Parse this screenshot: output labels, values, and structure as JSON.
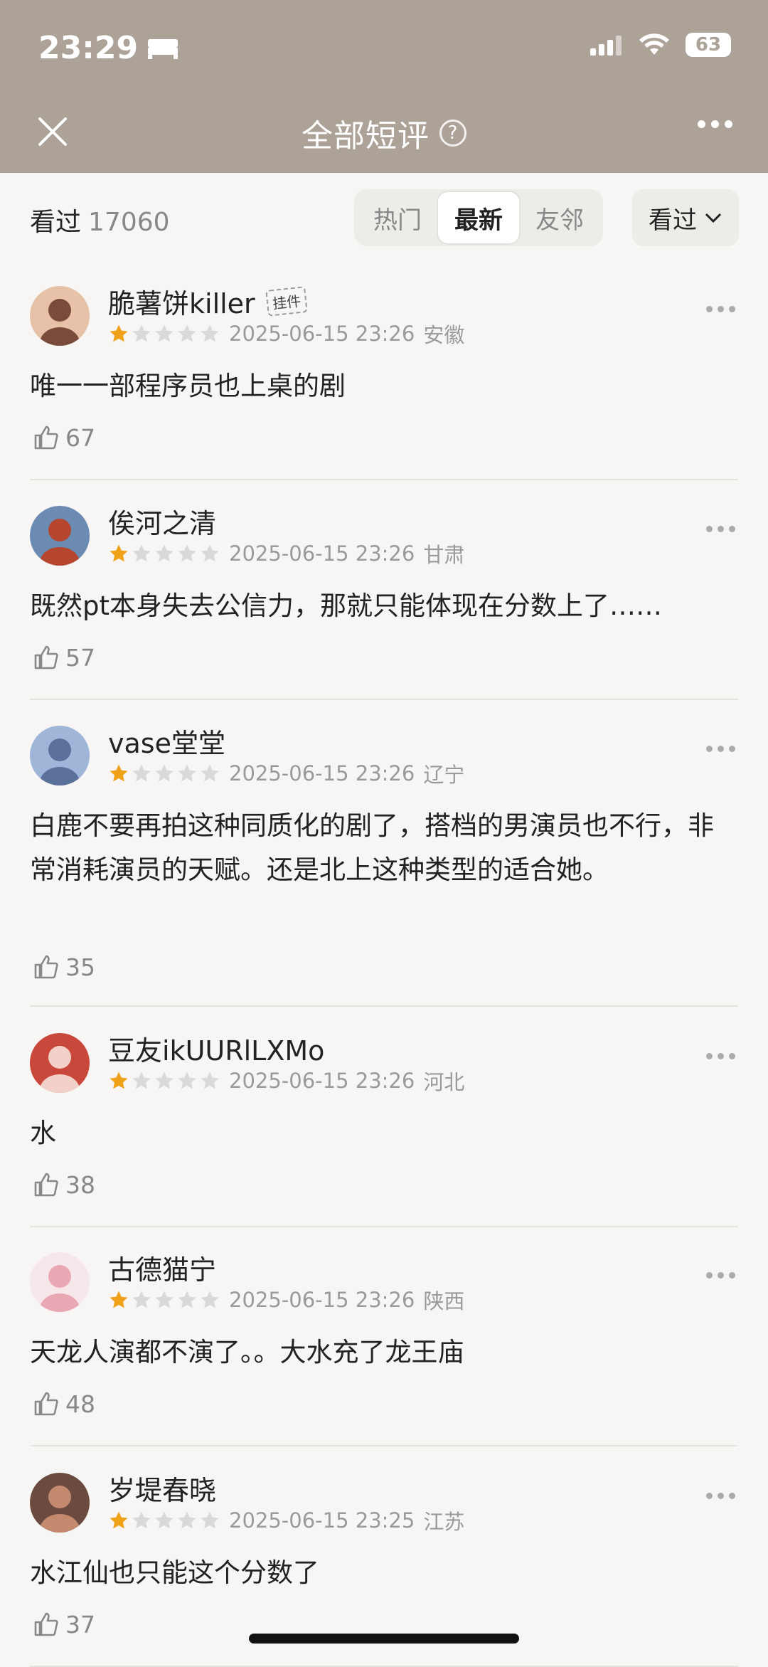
{
  "status": {
    "time": "23:29",
    "battery": "63"
  },
  "nav": {
    "title": "全部短评",
    "help": "?"
  },
  "filter": {
    "watched_label": "看过",
    "watched_count": "17060",
    "tabs": [
      "热门",
      "最新",
      "友邻"
    ],
    "active_tab": "最新",
    "dropdown_label": "看过"
  },
  "colors": {
    "header": "#aca298",
    "star": "#f0a11a",
    "star_empty": "#d9d9d9"
  },
  "reviews": [
    {
      "user": "脆薯饼killer",
      "badge": "挂件",
      "rating": 1,
      "time": "2025-06-15 23:26",
      "location": "安徽",
      "content": "唯一一部程序员也上桌的剧",
      "likes": "67"
    },
    {
      "user": "俟河之清",
      "badge": "",
      "rating": 1,
      "time": "2025-06-15 23:26",
      "location": "甘肃",
      "content": "既然pt本身失去公信力，那就只能体现在分数上了……",
      "likes": "57"
    },
    {
      "user": "vase堂堂",
      "badge": "",
      "rating": 1,
      "time": "2025-06-15 23:26",
      "location": "辽宁",
      "content": "白鹿不要再拍这种同质化的剧了，搭档的男演员也不行，非常消耗演员的天赋。还是北上这种类型的适合她。",
      "likes": "35"
    },
    {
      "user": "豆友ikUURlLXMo",
      "badge": "",
      "rating": 1,
      "time": "2025-06-15 23:26",
      "location": "河北",
      "content": "水",
      "likes": "38"
    },
    {
      "user": "古德猫宁",
      "badge": "",
      "rating": 1,
      "time": "2025-06-15 23:26",
      "location": "陕西",
      "content": "天龙人演都不演了。。大水充了龙王庙",
      "likes": "48"
    },
    {
      "user": "岁堤春晓",
      "badge": "",
      "rating": 1,
      "time": "2025-06-15 23:25",
      "location": "江苏",
      "content": "水江仙也只能这个分数了",
      "likes": "37"
    }
  ]
}
